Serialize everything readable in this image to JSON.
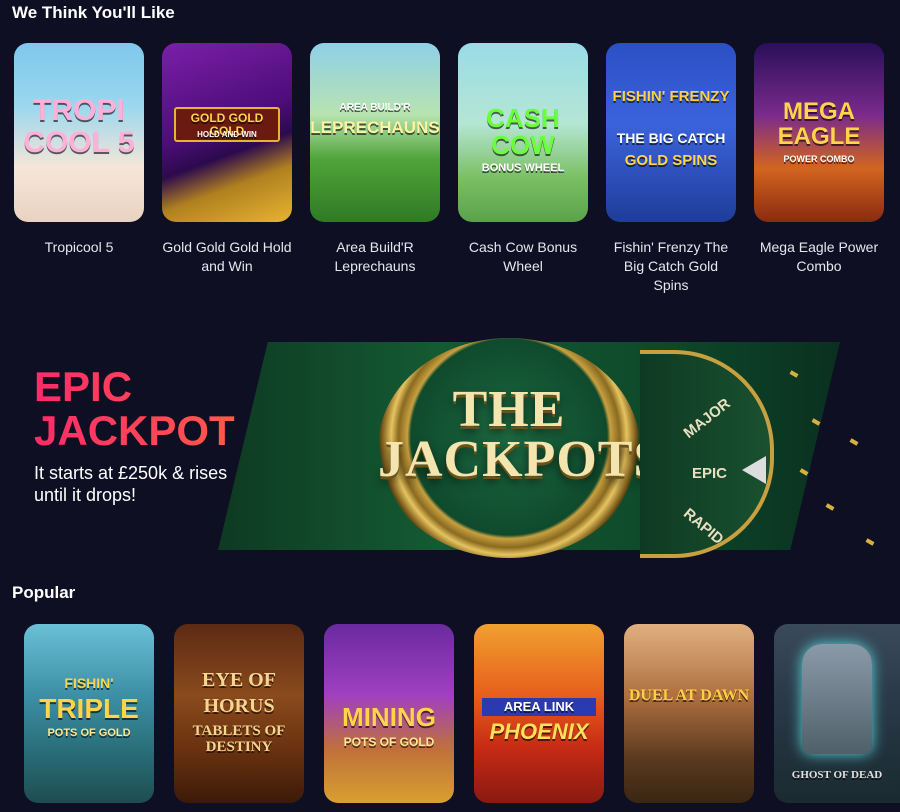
{
  "sections": {
    "recommended_title": "We Think You'll Like",
    "popular_title": "Popular"
  },
  "recommended": [
    {
      "name": "Tropicool 5",
      "art": "TROPI COOL 5"
    },
    {
      "name": "Gold Gold Gold Hold and Win",
      "art": "GOLD GOLD GOLD",
      "art_sub": "HOLD AND WIN"
    },
    {
      "name": "Area Build'R Leprechauns",
      "art_sub": "AREA BUILD'R",
      "art": "LEPRECHAUNS"
    },
    {
      "name": "Cash Cow Bonus Wheel",
      "art": "CASH COW",
      "art_sub": "BONUS WHEEL"
    },
    {
      "name": "Fishin' Frenzy The Big Catch Gold Spins",
      "art_top": "FISHIN' FRENZY",
      "art": "THE BIG CATCH",
      "art_sub": "GOLD SPINS"
    },
    {
      "name": "Mega Eagle Power Combo",
      "art": "MEGA EAGLE",
      "art_sub": "POWER COMBO"
    }
  ],
  "banner": {
    "epic_line1": "EPIC",
    "epic_line2": "JACKPOT",
    "subtitle": "It starts at £250k & rises until it drops!",
    "coin_text_line1": "THE",
    "coin_text_line2": "JACKPOTS",
    "wheel_labels": [
      "MAJOR",
      "EPIC",
      "RAPID"
    ]
  },
  "popular": [
    {
      "art_top": "FISHIN'",
      "art": "TRIPLE",
      "art_sub": "POTS OF GOLD"
    },
    {
      "art_top": "EYE OF",
      "art": "HORUS",
      "art_sub": "TABLETS OF DESTINY"
    },
    {
      "art": "MINING",
      "art_sub": "POTS OF GOLD"
    },
    {
      "art_top": "AREA LINK",
      "art": "PHOENIX"
    },
    {
      "art": "DUEL AT DAWN"
    },
    {
      "art_sub": "GHOST OF DEAD"
    }
  ],
  "colors": {
    "background": "#0f0f24",
    "epic_gradient_start": "#ff2a6a",
    "banner_green": "#145a33",
    "gold": "#c8a040"
  }
}
